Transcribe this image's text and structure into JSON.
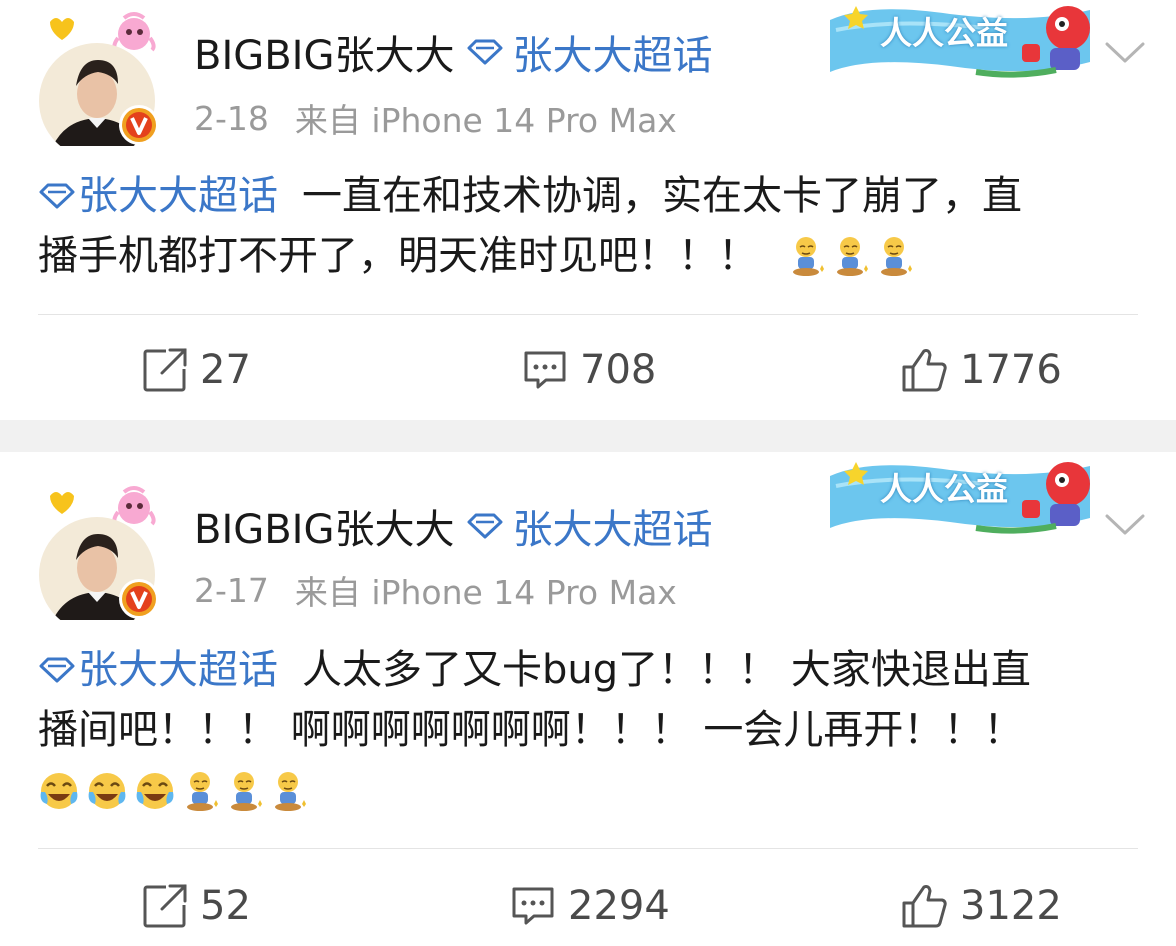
{
  "posts": [
    {
      "author": "BIGBIG张大大",
      "topic": "张大大超话",
      "date": "2-18",
      "source": "来自 iPhone 14 Pro Max",
      "content_tag": "张大大超话",
      "content_lines": [
        "一直在和技术协调，实在太卡了崩了，直",
        "播手机都打不开了，明天准时见吧！！！"
      ],
      "repost_count": "27",
      "comment_count": "708",
      "like_count": "1776"
    },
    {
      "author": "BIGBIG张大大",
      "topic": "张大大超话",
      "date": "2-17",
      "source": "来自 iPhone 14 Pro Max",
      "content_tag": "张大大超话",
      "content_lines": [
        "人太多了又卡bug了！！！ 大家快退出直",
        "播间吧！！！ 啊啊啊啊啊啊啊！！！ 一会儿再开！！！"
      ],
      "repost_count": "52",
      "comment_count": "2294",
      "like_count": "3122"
    }
  ],
  "banner_text": "人人公益",
  "colors": {
    "link": "#3b77c8",
    "badge": "#f0a020",
    "meta": "#9a9a9a"
  }
}
